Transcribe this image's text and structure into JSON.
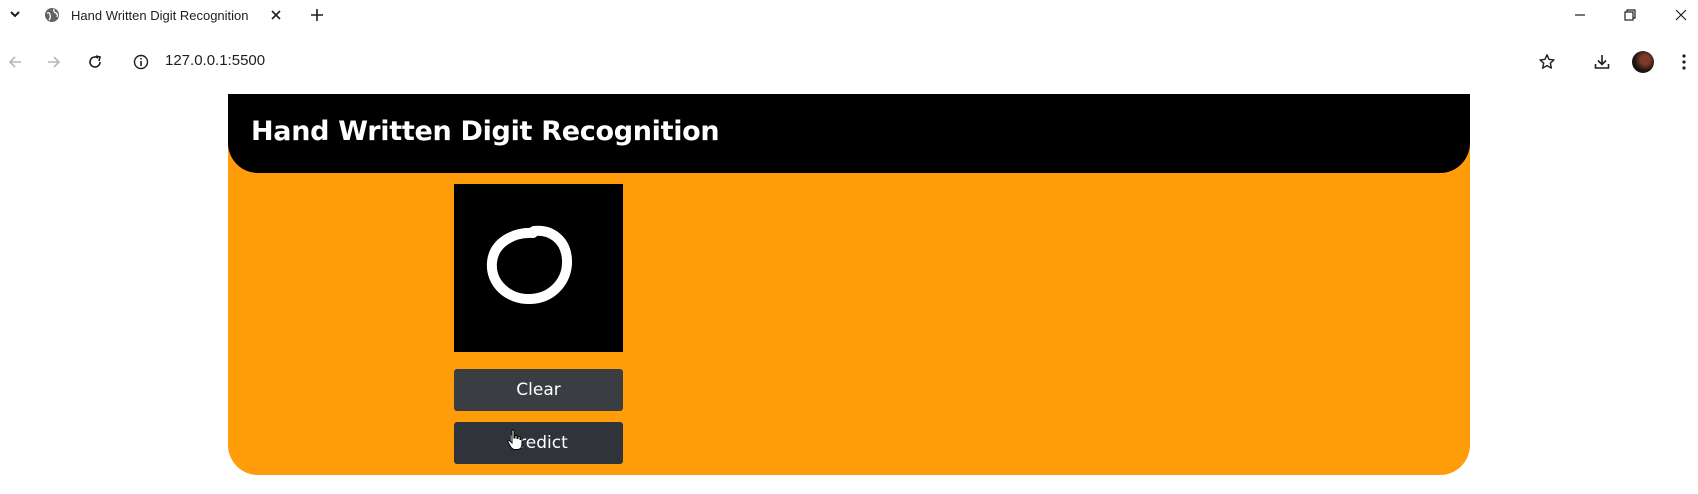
{
  "browser": {
    "tab": {
      "title": "Hand Written Digit Recognition"
    },
    "address": {
      "url": "127.0.0.1:5500"
    },
    "icons": {
      "tab_dropdown": "chevron-down-icon",
      "favicon": "globe-icon",
      "tab_close": "close-icon",
      "new_tab": "plus-icon",
      "back": "arrow-left-icon",
      "forward": "arrow-right-icon",
      "reload": "reload-icon",
      "site_info": "info-icon",
      "bookmark": "star-icon",
      "downloads": "download-icon",
      "menu": "kebab-menu-icon"
    }
  },
  "app": {
    "title": "Hand Written Digit Recognition",
    "buttons": {
      "clear": "Clear",
      "predict": "Predict"
    },
    "colors": {
      "background": "#ff9c0a",
      "header": "#000000",
      "canvas": "#000000",
      "button": "#3a3d42"
    }
  }
}
